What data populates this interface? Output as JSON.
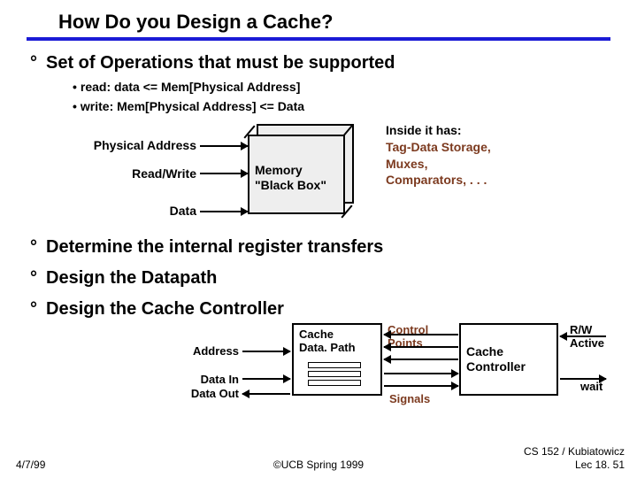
{
  "title": "How Do you Design a Cache?",
  "b1": "Set of Operations that must be supported",
  "s1": "read:  data <= Mem[Physical Address]",
  "s2": "write: Mem[Physical Address] <= Data",
  "mid": {
    "pa": "Physical Address",
    "rw": "Read/Write",
    "data": "Data",
    "box1": "Memory",
    "box2": "\"Black Box\""
  },
  "inside": {
    "l1": "Inside it has:",
    "l2": "Tag-Data Storage,",
    "l3": "Muxes,",
    "l4": "Comparators, . . ."
  },
  "b2": "Determine the internal register transfers",
  "b3": "Design the Datapath",
  "b4": "Design the Cache Controller",
  "lower": {
    "addr": "Address",
    "din": "Data In",
    "dout": "Data Out",
    "cdp1": "Cache",
    "cdp2": "Data. Path",
    "cp1": "Control",
    "cp2": "Points",
    "sig": "Signals",
    "cc1": "Cache",
    "cc2": "Controller",
    "rw1": "R/W",
    "rw2": "Active",
    "wait": "wait"
  },
  "footer": {
    "date": "4/7/99",
    "center": "©UCB Spring 1999",
    "r1": "CS 152 / Kubiatowicz",
    "r2": "Lec 18. 51"
  }
}
